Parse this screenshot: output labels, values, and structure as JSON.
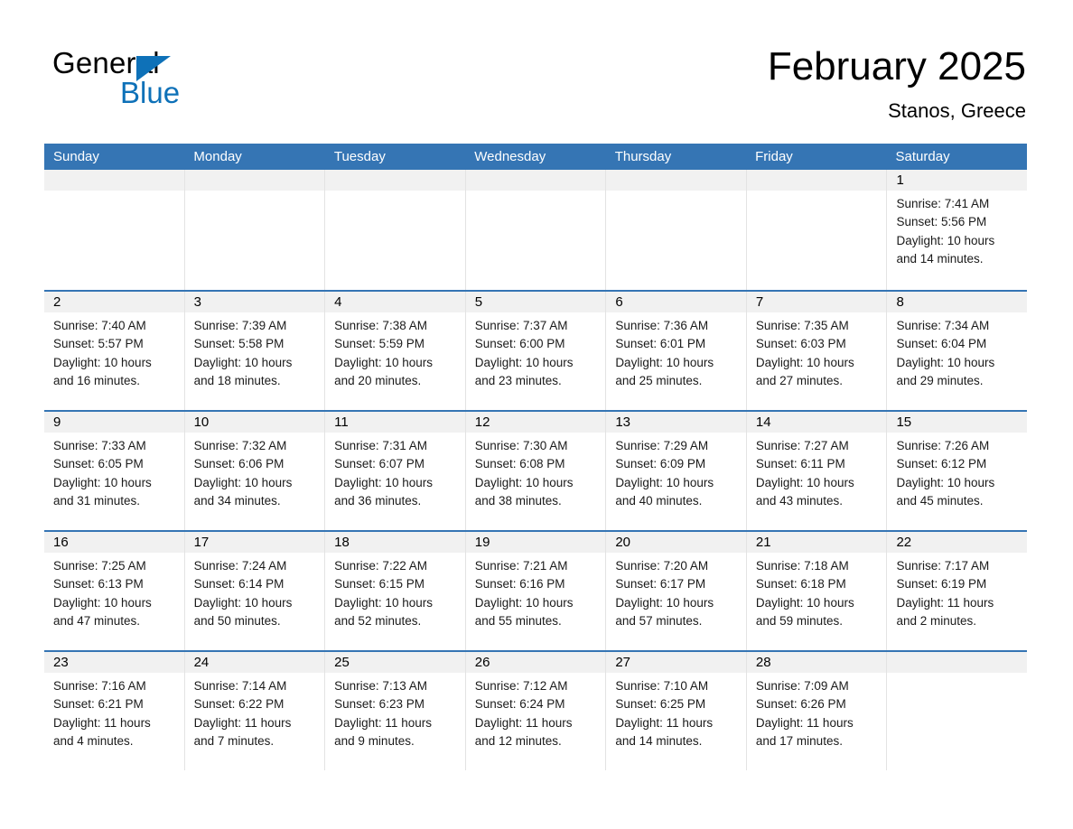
{
  "brand": {
    "name_part1": "General",
    "name_part2": "Blue",
    "accent_color": "#0e71b8",
    "triangle_icon": "triangle-icon"
  },
  "header": {
    "title": "February 2025",
    "location": "Stanos, Greece"
  },
  "theme": {
    "header_blue": "#3575b4",
    "band_gray": "#f1f1f1",
    "page_bg": "#ffffff"
  },
  "weekdays": [
    "Sunday",
    "Monday",
    "Tuesday",
    "Wednesday",
    "Thursday",
    "Friday",
    "Saturday"
  ],
  "weeks": [
    [
      {
        "empty": true
      },
      {
        "empty": true
      },
      {
        "empty": true
      },
      {
        "empty": true
      },
      {
        "empty": true
      },
      {
        "empty": true
      },
      {
        "empty": false,
        "date": "1",
        "sunrise": "Sunrise: 7:41 AM",
        "sunset": "Sunset: 5:56 PM",
        "daylight1": "Daylight: 10 hours",
        "daylight2": "and 14 minutes."
      }
    ],
    [
      {
        "empty": false,
        "date": "2",
        "sunrise": "Sunrise: 7:40 AM",
        "sunset": "Sunset: 5:57 PM",
        "daylight1": "Daylight: 10 hours",
        "daylight2": "and 16 minutes."
      },
      {
        "empty": false,
        "date": "3",
        "sunrise": "Sunrise: 7:39 AM",
        "sunset": "Sunset: 5:58 PM",
        "daylight1": "Daylight: 10 hours",
        "daylight2": "and 18 minutes."
      },
      {
        "empty": false,
        "date": "4",
        "sunrise": "Sunrise: 7:38 AM",
        "sunset": "Sunset: 5:59 PM",
        "daylight1": "Daylight: 10 hours",
        "daylight2": "and 20 minutes."
      },
      {
        "empty": false,
        "date": "5",
        "sunrise": "Sunrise: 7:37 AM",
        "sunset": "Sunset: 6:00 PM",
        "daylight1": "Daylight: 10 hours",
        "daylight2": "and 23 minutes."
      },
      {
        "empty": false,
        "date": "6",
        "sunrise": "Sunrise: 7:36 AM",
        "sunset": "Sunset: 6:01 PM",
        "daylight1": "Daylight: 10 hours",
        "daylight2": "and 25 minutes."
      },
      {
        "empty": false,
        "date": "7",
        "sunrise": "Sunrise: 7:35 AM",
        "sunset": "Sunset: 6:03 PM",
        "daylight1": "Daylight: 10 hours",
        "daylight2": "and 27 minutes."
      },
      {
        "empty": false,
        "date": "8",
        "sunrise": "Sunrise: 7:34 AM",
        "sunset": "Sunset: 6:04 PM",
        "daylight1": "Daylight: 10 hours",
        "daylight2": "and 29 minutes."
      }
    ],
    [
      {
        "empty": false,
        "date": "9",
        "sunrise": "Sunrise: 7:33 AM",
        "sunset": "Sunset: 6:05 PM",
        "daylight1": "Daylight: 10 hours",
        "daylight2": "and 31 minutes."
      },
      {
        "empty": false,
        "date": "10",
        "sunrise": "Sunrise: 7:32 AM",
        "sunset": "Sunset: 6:06 PM",
        "daylight1": "Daylight: 10 hours",
        "daylight2": "and 34 minutes."
      },
      {
        "empty": false,
        "date": "11",
        "sunrise": "Sunrise: 7:31 AM",
        "sunset": "Sunset: 6:07 PM",
        "daylight1": "Daylight: 10 hours",
        "daylight2": "and 36 minutes."
      },
      {
        "empty": false,
        "date": "12",
        "sunrise": "Sunrise: 7:30 AM",
        "sunset": "Sunset: 6:08 PM",
        "daylight1": "Daylight: 10 hours",
        "daylight2": "and 38 minutes."
      },
      {
        "empty": false,
        "date": "13",
        "sunrise": "Sunrise: 7:29 AM",
        "sunset": "Sunset: 6:09 PM",
        "daylight1": "Daylight: 10 hours",
        "daylight2": "and 40 minutes."
      },
      {
        "empty": false,
        "date": "14",
        "sunrise": "Sunrise: 7:27 AM",
        "sunset": "Sunset: 6:11 PM",
        "daylight1": "Daylight: 10 hours",
        "daylight2": "and 43 minutes."
      },
      {
        "empty": false,
        "date": "15",
        "sunrise": "Sunrise: 7:26 AM",
        "sunset": "Sunset: 6:12 PM",
        "daylight1": "Daylight: 10 hours",
        "daylight2": "and 45 minutes."
      }
    ],
    [
      {
        "empty": false,
        "date": "16",
        "sunrise": "Sunrise: 7:25 AM",
        "sunset": "Sunset: 6:13 PM",
        "daylight1": "Daylight: 10 hours",
        "daylight2": "and 47 minutes."
      },
      {
        "empty": false,
        "date": "17",
        "sunrise": "Sunrise: 7:24 AM",
        "sunset": "Sunset: 6:14 PM",
        "daylight1": "Daylight: 10 hours",
        "daylight2": "and 50 minutes."
      },
      {
        "empty": false,
        "date": "18",
        "sunrise": "Sunrise: 7:22 AM",
        "sunset": "Sunset: 6:15 PM",
        "daylight1": "Daylight: 10 hours",
        "daylight2": "and 52 minutes."
      },
      {
        "empty": false,
        "date": "19",
        "sunrise": "Sunrise: 7:21 AM",
        "sunset": "Sunset: 6:16 PM",
        "daylight1": "Daylight: 10 hours",
        "daylight2": "and 55 minutes."
      },
      {
        "empty": false,
        "date": "20",
        "sunrise": "Sunrise: 7:20 AM",
        "sunset": "Sunset: 6:17 PM",
        "daylight1": "Daylight: 10 hours",
        "daylight2": "and 57 minutes."
      },
      {
        "empty": false,
        "date": "21",
        "sunrise": "Sunrise: 7:18 AM",
        "sunset": "Sunset: 6:18 PM",
        "daylight1": "Daylight: 10 hours",
        "daylight2": "and 59 minutes."
      },
      {
        "empty": false,
        "date": "22",
        "sunrise": "Sunrise: 7:17 AM",
        "sunset": "Sunset: 6:19 PM",
        "daylight1": "Daylight: 11 hours",
        "daylight2": "and 2 minutes."
      }
    ],
    [
      {
        "empty": false,
        "date": "23",
        "sunrise": "Sunrise: 7:16 AM",
        "sunset": "Sunset: 6:21 PM",
        "daylight1": "Daylight: 11 hours",
        "daylight2": "and 4 minutes."
      },
      {
        "empty": false,
        "date": "24",
        "sunrise": "Sunrise: 7:14 AM",
        "sunset": "Sunset: 6:22 PM",
        "daylight1": "Daylight: 11 hours",
        "daylight2": "and 7 minutes."
      },
      {
        "empty": false,
        "date": "25",
        "sunrise": "Sunrise: 7:13 AM",
        "sunset": "Sunset: 6:23 PM",
        "daylight1": "Daylight: 11 hours",
        "daylight2": "and 9 minutes."
      },
      {
        "empty": false,
        "date": "26",
        "sunrise": "Sunrise: 7:12 AM",
        "sunset": "Sunset: 6:24 PM",
        "daylight1": "Daylight: 11 hours",
        "daylight2": "and 12 minutes."
      },
      {
        "empty": false,
        "date": "27",
        "sunrise": "Sunrise: 7:10 AM",
        "sunset": "Sunset: 6:25 PM",
        "daylight1": "Daylight: 11 hours",
        "daylight2": "and 14 minutes."
      },
      {
        "empty": false,
        "date": "28",
        "sunrise": "Sunrise: 7:09 AM",
        "sunset": "Sunset: 6:26 PM",
        "daylight1": "Daylight: 11 hours",
        "daylight2": "and 17 minutes."
      },
      {
        "empty": true
      }
    ]
  ]
}
